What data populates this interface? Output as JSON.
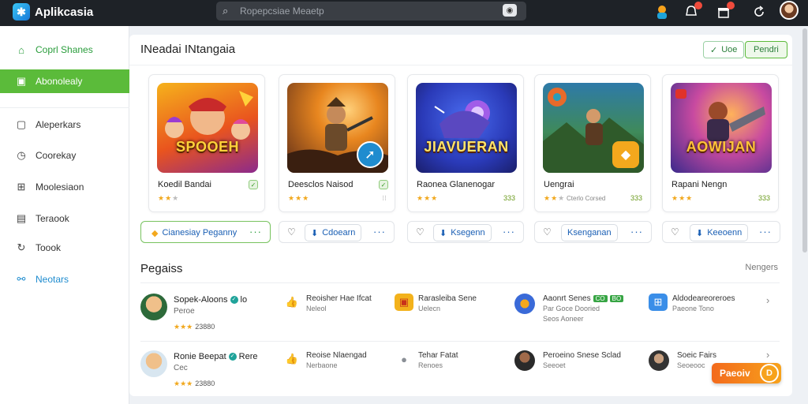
{
  "app": {
    "title": "Aplikcasia"
  },
  "search": {
    "placeholder": "Ropepcsiae Meaetp"
  },
  "header_icons": [
    "figure-icon",
    "notification-icon",
    "gift-icon",
    "refresh-icon",
    "user-avatar"
  ],
  "sidebar": {
    "items": [
      {
        "label": "Coprl Shanes",
        "icon": "home-icon"
      },
      {
        "label": "Abonolealy",
        "icon": "image-icon"
      },
      {
        "label": "Aleperkars",
        "icon": "square-icon"
      },
      {
        "label": "Coorekay",
        "icon": "clock-icon"
      },
      {
        "label": "Moolesiaon",
        "icon": "grid-icon"
      },
      {
        "label": "Teraook",
        "icon": "book-icon"
      },
      {
        "label": "Toook",
        "icon": "refresh-icon"
      },
      {
        "label": "Neotars",
        "icon": "link-icon"
      }
    ]
  },
  "main": {
    "title": "INeadai INtangaia",
    "btn_outline_label": "Uoe",
    "btn_green_label": "Pendri"
  },
  "cards": [
    {
      "art_text": "SPOOEH",
      "title": "Koedil Bandai",
      "rating_meta": "",
      "price": ""
    },
    {
      "art_text": "",
      "title": "Deesclos Naisod",
      "rating_meta": "",
      "price": ""
    },
    {
      "art_text": "JIAVUERAN",
      "title": "Raonea Glanenogar",
      "rating_meta": "",
      "price": "333"
    },
    {
      "art_text": "",
      "title": "Uengrai",
      "rating_meta": "Cterlo Corsed",
      "price": "333"
    },
    {
      "art_text": "AOWIJAN",
      "title": "Rapani Nengn",
      "rating_meta": "",
      "price": "333"
    }
  ],
  "actions": [
    {
      "label": "Cianesiay Peganny",
      "dots": "···"
    },
    {
      "label": "Cdoearn",
      "dots": "···"
    },
    {
      "label": "Ksegenn",
      "dots": "···"
    },
    {
      "label": "Ksenganan",
      "dots": "···"
    },
    {
      "label": "Keeoenn",
      "dots": "···"
    }
  ],
  "section": {
    "title": "Pegaiss",
    "link": "Nengers"
  },
  "feed": [
    {
      "name": "Sopek-Aloons",
      "name_extra": "lo",
      "sub": "Peroe",
      "rating": "★★★",
      "count": "23880",
      "items": [
        {
          "title": "Reoisher Hae Ifcat",
          "sub": "Neleol",
          "sub2": "",
          "icon": "like-icon"
        },
        {
          "title": "Rarasleiba Sene",
          "sub": "Uelecn",
          "sub2": "",
          "icon": "cube-icon"
        },
        {
          "title": "Aaonrt Senes",
          "tag1": "CO",
          "tag2": "BO",
          "sub": "Par Goce Dooried",
          "sub2": "Seos Aoneer",
          "icon": "game-icon"
        },
        {
          "title": "Aldodeareoreroes",
          "sub": "Paeone Tono",
          "sub2": "",
          "icon": "apps-icon"
        }
      ]
    },
    {
      "name": "Ronie Beepat",
      "name_extra": "Rere",
      "sub": "Cec",
      "rating": "★★★",
      "count": "23880",
      "items": [
        {
          "title": "Reoise Nlaengad",
          "sub": "Nerbaone",
          "sub2": "",
          "icon": "like-icon"
        },
        {
          "title": "Tehar Fatat",
          "sub": "Renoes",
          "sub2": "",
          "icon": "elephant-icon"
        },
        {
          "title": "Peroeino Snese Sclad",
          "sub": "Seeoet",
          "sub2": "",
          "icon": "person-icon"
        },
        {
          "title": "Soeic Fairs",
          "sub": "Seoeooc",
          "sub2": "",
          "icon": "portrait-icon"
        }
      ]
    }
  ],
  "fab": {
    "label": "Paeoiv",
    "circle": "D"
  }
}
